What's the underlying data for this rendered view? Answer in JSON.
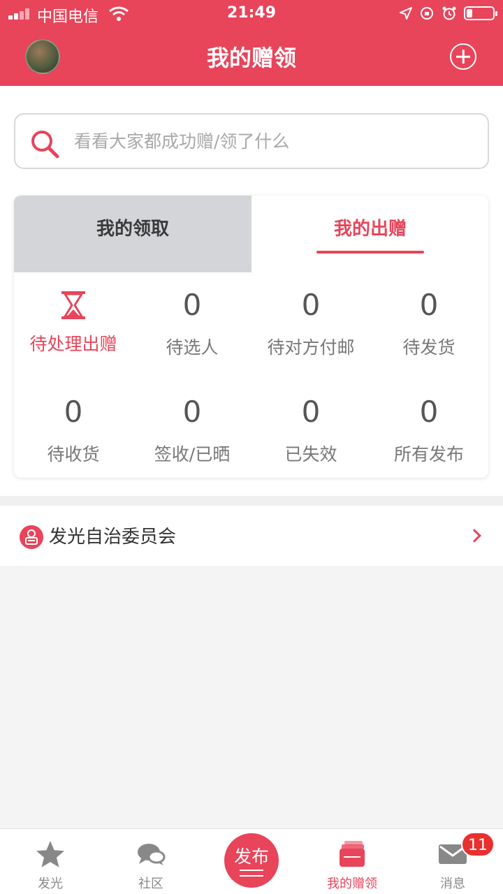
{
  "status_bar": {
    "carrier": "中国电信",
    "time": "21:49"
  },
  "header": {
    "title": "我的赠领"
  },
  "search": {
    "placeholder": "看看大家都成功赠/领了什么"
  },
  "tabs": {
    "received": "我的领取",
    "given": "我的出赠",
    "active": "given"
  },
  "stats": [
    {
      "label": "待处理出赠",
      "icon": "hourglass-icon"
    },
    {
      "label": "待选人",
      "count": "0"
    },
    {
      "label": "待对方付邮",
      "count": "0"
    },
    {
      "label": "待发货",
      "count": "0"
    },
    {
      "label": "待收货",
      "count": "0"
    },
    {
      "label": "签收/已晒",
      "count": "0"
    },
    {
      "label": "已失效",
      "count": "0"
    },
    {
      "label": "所有发布",
      "count": "0"
    }
  ],
  "community_row": {
    "label": "发光自治委员会"
  },
  "tabbar": {
    "items": [
      {
        "label": "发光",
        "icon": "star-icon"
      },
      {
        "label": "社区",
        "icon": "chat-bubbles-icon"
      },
      {
        "label": "我的赠领",
        "icon": "cards-icon",
        "active": true
      },
      {
        "label": "消息",
        "icon": "envelope-icon"
      }
    ],
    "publish_label": "发布",
    "message_badge": "11"
  },
  "colors": {
    "accent": "#e8445a",
    "tab_inactive_bg": "#d4d5d8",
    "page_bg": "#f4f4f4"
  }
}
